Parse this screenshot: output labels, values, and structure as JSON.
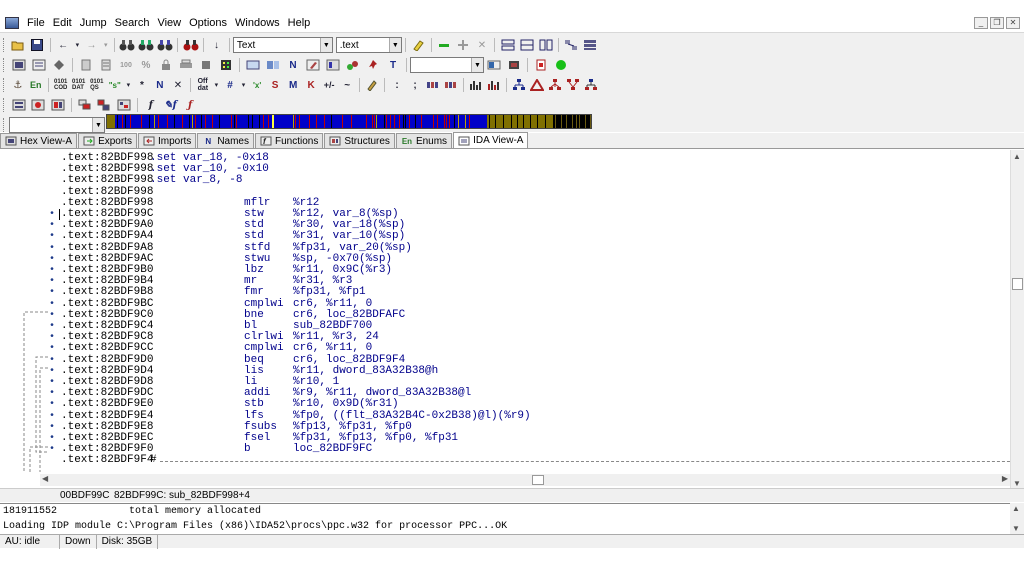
{
  "menu": [
    "File",
    "Edit",
    "Jump",
    "Search",
    "View",
    "Options",
    "Windows",
    "Help"
  ],
  "toolbar": {
    "segment_type": "Text",
    "segment_name": ".text",
    "row3_labels": {
      "en": "En",
      "cod": "0101\nCOD",
      "dat": "0101\nDAT",
      "qs": "0101\nQS",
      "n": "N",
      "s": "S",
      "m": "M",
      "k": "K",
      "t": "T"
    }
  },
  "tabs": [
    {
      "label": "Hex View-A",
      "icon": "hex-view-icon",
      "active": false
    },
    {
      "label": "Exports",
      "icon": "exports-icon",
      "active": false
    },
    {
      "label": "Imports",
      "icon": "imports-icon",
      "active": false
    },
    {
      "label": "Names",
      "icon": "names-icon",
      "glyph": "N",
      "active": false
    },
    {
      "label": "Functions",
      "icon": "functions-icon",
      "active": false
    },
    {
      "label": "Structures",
      "icon": "structures-icon",
      "active": false
    },
    {
      "label": "Enums",
      "icon": "enums-icon",
      "glyph": "En",
      "active": false
    },
    {
      "label": "IDA View-A",
      "icon": "ida-view-icon",
      "active": true
    }
  ],
  "disasm": {
    "lines": [
      {
        "addr": ".text:82BDF998",
        "set": ".set var_18, -0x18"
      },
      {
        "addr": ".text:82BDF998",
        "set": ".set var_10, -0x10"
      },
      {
        "addr": ".text:82BDF998",
        "set": ".set var_8, -8"
      },
      {
        "addr": ".text:82BDF998"
      },
      {
        "addr": ".text:82BDF998",
        "mnem": "mflr",
        "ops": "%r12"
      },
      {
        "addr": ".text:82BDF99C",
        "mnem": "stw",
        "ops": "%r12, var_8(%sp)",
        "bullet": true,
        "cursor": true
      },
      {
        "addr": ".text:82BDF9A0",
        "mnem": "std",
        "ops": "%r30, var_18(%sp)",
        "bullet": true
      },
      {
        "addr": ".text:82BDF9A4",
        "mnem": "std",
        "ops": "%r31, var_10(%sp)",
        "bullet": true
      },
      {
        "addr": ".text:82BDF9A8",
        "mnem": "stfd",
        "ops": "%fp31, var_20(%sp)",
        "bullet": true
      },
      {
        "addr": ".text:82BDF9AC",
        "mnem": "stwu",
        "ops": "%sp, -0x70(%sp)",
        "bullet": true
      },
      {
        "addr": ".text:82BDF9B0",
        "mnem": "lbz",
        "ops": "%r11, 0x9C(%r3)",
        "bullet": true
      },
      {
        "addr": ".text:82BDF9B4",
        "mnem": "mr",
        "ops": "%r31, %r3",
        "bullet": true
      },
      {
        "addr": ".text:82BDF9B8",
        "mnem": "fmr",
        "ops": "%fp31, %fp1",
        "bullet": true
      },
      {
        "addr": ".text:82BDF9BC",
        "mnem": "cmplwi",
        "ops": "cr6, %r11, 0",
        "bullet": true
      },
      {
        "addr": ".text:82BDF9C0",
        "mnem": "bne",
        "ops": "cr6, loc_82BDFAFC",
        "bullet": true
      },
      {
        "addr": ".text:82BDF9C4",
        "mnem": "bl",
        "ops": "sub_82BDF700",
        "bullet": true
      },
      {
        "addr": ".text:82BDF9C8",
        "mnem": "clrlwi",
        "ops": "%r11, %r3, 24",
        "bullet": true
      },
      {
        "addr": ".text:82BDF9CC",
        "mnem": "cmplwi",
        "ops": "cr6, %r11, 0",
        "bullet": true
      },
      {
        "addr": ".text:82BDF9D0",
        "mnem": "beq",
        "ops": "cr6, loc_82BDF9F4",
        "bullet": true
      },
      {
        "addr": ".text:82BDF9D4",
        "mnem": "lis",
        "ops": "%r11, dword_83A32B38@h",
        "bullet": true
      },
      {
        "addr": ".text:82BDF9D8",
        "mnem": "li",
        "ops": "%r10, 1",
        "bullet": true
      },
      {
        "addr": ".text:82BDF9DC",
        "mnem": "addi",
        "ops": "%r9, %r11, dword_83A32B38@l",
        "bullet": true
      },
      {
        "addr": ".text:82BDF9E0",
        "mnem": "stb",
        "ops": "%r10, 0x9D(%r31)",
        "bullet": true
      },
      {
        "addr": ".text:82BDF9E4",
        "mnem": "lfs",
        "ops": "%fp0, ((flt_83A32B4C-0x2B38)@l)(%r9)",
        "bullet": true
      },
      {
        "addr": ".text:82BDF9E8",
        "mnem": "fsubs",
        "ops": "%fp13, %fp31, %fp0",
        "bullet": true
      },
      {
        "addr": ".text:82BDF9EC",
        "mnem": "fsel",
        "ops": "%fp31, %fp13, %fp0, %fp31",
        "bullet": true
      },
      {
        "addr": ".text:82BDF9F0",
        "mnem": "b",
        "ops": "loc_82BDF9FC",
        "bullet": true
      },
      {
        "addr": ".text:82BDF9F4",
        "end": "#"
      }
    ]
  },
  "view_status": {
    "offset": "00BDF99C",
    "location": "82BDF99C: sub_82BDF998+4"
  },
  "output": {
    "lines": [
      "181911552            total memory allocated",
      "Loading IDP module C:\\Program Files (x86)\\IDA52\\procs\\ppc.w32 for processor PPC...OK"
    ]
  },
  "status": {
    "au": "AU: idle",
    "dir": "Down",
    "disk": "Disk: 35GB"
  },
  "colors": {
    "code_blue": "#00008b",
    "nav_blue": "#0000c8",
    "nav_olive": "#807000",
    "nav_red": "#c00000"
  }
}
